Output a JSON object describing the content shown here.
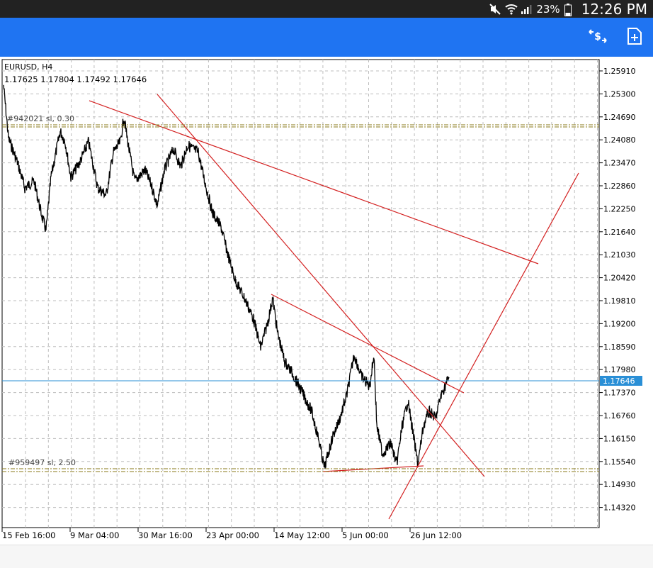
{
  "status_bar": {
    "battery": "23%",
    "time": "12:26 PM",
    "icons": [
      "mute-icon",
      "wifi-icon",
      "signal-icon",
      "battery-icon"
    ]
  },
  "app_bar": {
    "color": "#1f74f2",
    "icons": [
      "currency-swap-icon",
      "new-order-icon"
    ]
  },
  "chart": {
    "symbol_line": "EURUSD, H4",
    "ohlc_line": "1.17625 1.17804 1.17492 1.17646",
    "current_price": "1.17646",
    "price_levels": [
      "1.25910",
      "1.25300",
      "1.24690",
      "1.24080",
      "1.23470",
      "1.22860",
      "1.22250",
      "1.21640",
      "1.21030",
      "1.20420",
      "1.19810",
      "1.19200",
      "1.18590",
      "1.17980",
      "1.17370",
      "1.16760",
      "1.16150",
      "1.15540",
      "1.14930",
      "1.14320"
    ],
    "time_labels": [
      "15 Feb 16:00",
      "9 Mar 04:00",
      "30 Mar 16:00",
      "23 Apr 00:00",
      "14 May 12:00",
      "5 Jun 00:00",
      "26 Jun 12:00"
    ],
    "orders": [
      {
        "id": "#942021",
        "type": "sl",
        "volume": "0.30"
      },
      {
        "id": "#959497",
        "type": "sl",
        "volume": "2.50"
      }
    ],
    "colors": {
      "price": "#000000",
      "trendlines": "#d32020",
      "bid_line": "#2a8fd6",
      "order_line": "#8a7a1a",
      "grid": "#bdbdbd"
    }
  }
}
